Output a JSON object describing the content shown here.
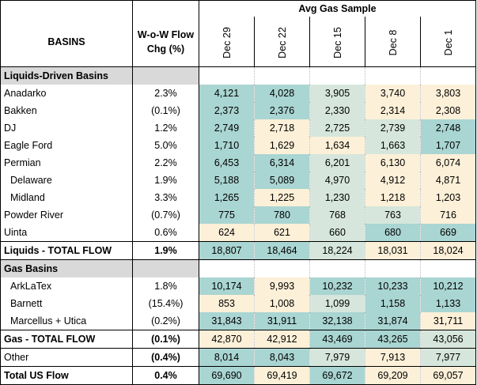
{
  "header": {
    "group_title": "Avg Gas Sample",
    "basins_label": "BASINS",
    "flow_label": "W-o-W Flow Chg (%)",
    "dates": [
      "Dec 29",
      "Dec 22",
      "Dec 15",
      "Dec 8",
      "Dec 1"
    ]
  },
  "rows": [
    {
      "type": "section",
      "name": "Liquids-Driven Basins"
    },
    {
      "name": "Anadarko",
      "flow": "2.3%",
      "values": [
        "4,121",
        "4,028",
        "3,905",
        "3,740",
        "3,803"
      ]
    },
    {
      "name": "Bakken",
      "flow": "(0.1%)",
      "values": [
        "2,373",
        "2,376",
        "2,330",
        "2,314",
        "2,308"
      ]
    },
    {
      "name": "DJ",
      "flow": "1.2%",
      "values": [
        "2,749",
        "2,718",
        "2,725",
        "2,739",
        "2,748"
      ]
    },
    {
      "name": "Eagle Ford",
      "flow": "5.0%",
      "values": [
        "1,710",
        "1,629",
        "1,634",
        "1,663",
        "1,707"
      ]
    },
    {
      "name": "Permian",
      "flow": "2.2%",
      "values": [
        "6,453",
        "6,314",
        "6,201",
        "6,130",
        "6,074"
      ]
    },
    {
      "name": "Delaware",
      "indent": true,
      "flow": "1.9%",
      "values": [
        "5,188",
        "5,089",
        "4,970",
        "4,912",
        "4,871"
      ]
    },
    {
      "name": "Midland",
      "indent": true,
      "flow": "3.3%",
      "values": [
        "1,265",
        "1,225",
        "1,230",
        "1,218",
        "1,203"
      ]
    },
    {
      "name": "Powder River",
      "flow": "(0.7%)",
      "values": [
        "775",
        "780",
        "768",
        "763",
        "716"
      ]
    },
    {
      "name": "Uinta",
      "flow": "0.6%",
      "values": [
        "624",
        "621",
        "660",
        "680",
        "669"
      ]
    },
    {
      "type": "total",
      "name": "Liquids - TOTAL FLOW",
      "flow": "1.9%",
      "values": [
        "18,807",
        "18,464",
        "18,224",
        "18,031",
        "18,024"
      ]
    },
    {
      "type": "section",
      "name": "Gas Basins"
    },
    {
      "name": "ArkLaTex",
      "indent": true,
      "flow": "1.8%",
      "values": [
        "10,174",
        "9,993",
        "10,232",
        "10,233",
        "10,212"
      ]
    },
    {
      "name": "Barnett",
      "indent": true,
      "flow": "(15.4%)",
      "values": [
        "853",
        "1,008",
        "1,099",
        "1,158",
        "1,133"
      ]
    },
    {
      "name": "Marcellus + Utica",
      "indent": true,
      "flow": "(0.2%)",
      "values": [
        "31,843",
        "31,911",
        "32,138",
        "31,874",
        "31,711"
      ]
    },
    {
      "type": "total",
      "name": "Gas - TOTAL FLOW",
      "flow": "(0.1%)",
      "values": [
        "42,870",
        "42,912",
        "43,469",
        "43,265",
        "43,056"
      ]
    },
    {
      "name": "Other",
      "flow": "(0.4%)",
      "flow_bold": true,
      "values": [
        "8,014",
        "8,043",
        "7,979",
        "7,913",
        "7,977"
      ]
    },
    {
      "type": "total",
      "name": "Total US Flow",
      "flow": "0.4%",
      "values": [
        "69,690",
        "69,419",
        "69,672",
        "69,209",
        "69,057"
      ]
    }
  ],
  "colors": {
    "teal": "#a9d5d2",
    "cream": "#fdf0d8",
    "section_gray": "#d9d9d9"
  }
}
